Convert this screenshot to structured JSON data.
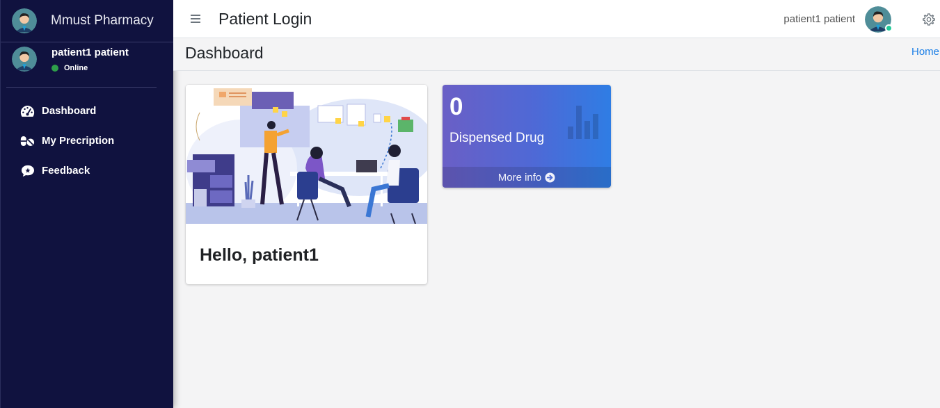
{
  "sidebar": {
    "brand": "Mmust Pharmacy",
    "user": {
      "name": "patient1 patient",
      "status": "Online"
    },
    "items": [
      {
        "label": "Dashboard",
        "icon": "tachometer-icon"
      },
      {
        "label": "My Precription",
        "icon": "pills-icon"
      },
      {
        "label": "Feedback",
        "icon": "comment-icon"
      }
    ]
  },
  "topbar": {
    "title": "Patient Login",
    "user_name": "patient1 patient"
  },
  "content_header": {
    "title": "Dashboard",
    "breadcrumb": "Home"
  },
  "welcome_card": {
    "greeting": "Hello, patient1"
  },
  "stat_box": {
    "count": "0",
    "label": "Dispensed Drug",
    "footer": "More info",
    "icon": "bar-chart-icon"
  },
  "colors": {
    "sidebar_bg": "#10123f",
    "link": "#1a7ee6",
    "online": "#2e9e4a",
    "online_badge": "#20c997",
    "stat_gradient_start": "#6a5fc6",
    "stat_gradient_end": "#2f7de4"
  }
}
